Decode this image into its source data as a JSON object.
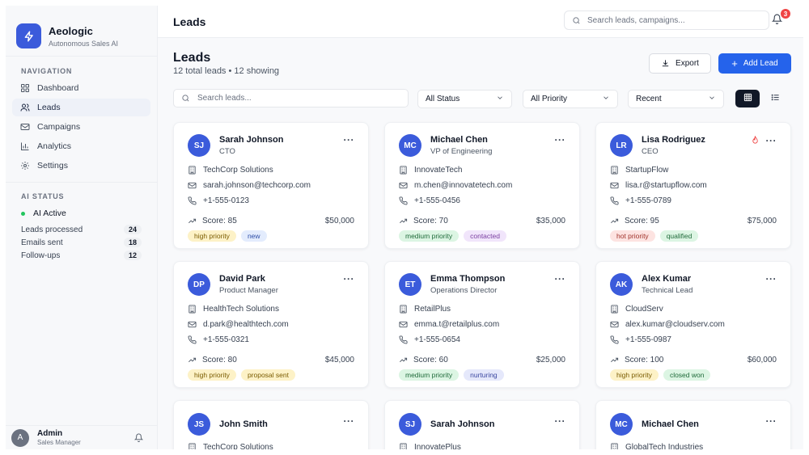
{
  "app": {
    "name": "Aeologic",
    "tagline": "Autonomous Sales AI"
  },
  "sidebar": {
    "nav_heading": "NAVIGATION",
    "nav": [
      {
        "label": "Dashboard",
        "icon": "grid-icon",
        "active": false
      },
      {
        "label": "Leads",
        "icon": "users-icon",
        "active": true
      },
      {
        "label": "Campaigns",
        "icon": "mail-icon",
        "active": false
      },
      {
        "label": "Analytics",
        "icon": "bar-chart-icon",
        "active": false
      },
      {
        "label": "Settings",
        "icon": "gear-icon",
        "active": false
      }
    ],
    "ai_heading": "AI STATUS",
    "ai_active": "AI Active",
    "stats": [
      {
        "label": "Leads processed",
        "value": "24"
      },
      {
        "label": "Emails sent",
        "value": "18"
      },
      {
        "label": "Follow-ups",
        "value": "12"
      }
    ],
    "user": {
      "initial": "A",
      "name": "Admin",
      "role": "Sales Manager"
    }
  },
  "topbar": {
    "title": "Leads",
    "search_placeholder": "Search leads, campaigns...",
    "notifications": "3"
  },
  "header": {
    "title": "Leads",
    "subtitle": "12 total leads • 12 showing",
    "export_label": "Export",
    "add_label": "Add Lead"
  },
  "filters": {
    "search_placeholder": "Search leads...",
    "status": "All Status",
    "priority": "All Priority",
    "sort": "Recent"
  },
  "leads": [
    {
      "initials": "SJ",
      "name": "Sarah Johnson",
      "title": "CTO",
      "company": "TechCorp Solutions",
      "email": "sarah.johnson@techcorp.com",
      "phone": "+1-555-0123",
      "score": "Score: 85",
      "value": "$50,000",
      "priority": "high priority",
      "status": "new",
      "hot": false
    },
    {
      "initials": "MC",
      "name": "Michael Chen",
      "title": "VP of Engineering",
      "company": "InnovateTech",
      "email": "m.chen@innovatetech.com",
      "phone": "+1-555-0456",
      "score": "Score: 70",
      "value": "$35,000",
      "priority": "medium priority",
      "status": "contacted",
      "hot": false
    },
    {
      "initials": "LR",
      "name": "Lisa Rodriguez",
      "title": "CEO",
      "company": "StartupFlow",
      "email": "lisa.r@startupflow.com",
      "phone": "+1-555-0789",
      "score": "Score: 95",
      "value": "$75,000",
      "priority": "hot priority",
      "status": "qualified",
      "hot": true
    },
    {
      "initials": "DP",
      "name": "David Park",
      "title": "Product Manager",
      "company": "HealthTech Solutions",
      "email": "d.park@healthtech.com",
      "phone": "+1-555-0321",
      "score": "Score: 80",
      "value": "$45,000",
      "priority": "high priority",
      "status": "proposal sent",
      "hot": false
    },
    {
      "initials": "ET",
      "name": "Emma Thompson",
      "title": "Operations Director",
      "company": "RetailPlus",
      "email": "emma.t@retailplus.com",
      "phone": "+1-555-0654",
      "score": "Score: 60",
      "value": "$25,000",
      "priority": "medium priority",
      "status": "nurturing",
      "hot": false
    },
    {
      "initials": "AK",
      "name": "Alex Kumar",
      "title": "Technical Lead",
      "company": "CloudServ",
      "email": "alex.kumar@cloudserv.com",
      "phone": "+1-555-0987",
      "score": "Score: 100",
      "value": "$60,000",
      "priority": "high priority",
      "status": "closed won",
      "hot": false
    },
    {
      "initials": "JS",
      "name": "John Smith",
      "company": "TechCorp Solutions"
    },
    {
      "initials": "SJ",
      "name": "Sarah Johnson",
      "company": "InnovatePlus"
    },
    {
      "initials": "MC",
      "name": "Michael Chen",
      "company": "GlobalTech Industries"
    }
  ],
  "colors": {
    "accent": "#2563eb",
    "avatar": "#3b5bdb",
    "sidebar_active": "#eef1f8",
    "ai_active_dot": "#22c55e",
    "notification": "#ef4444"
  }
}
